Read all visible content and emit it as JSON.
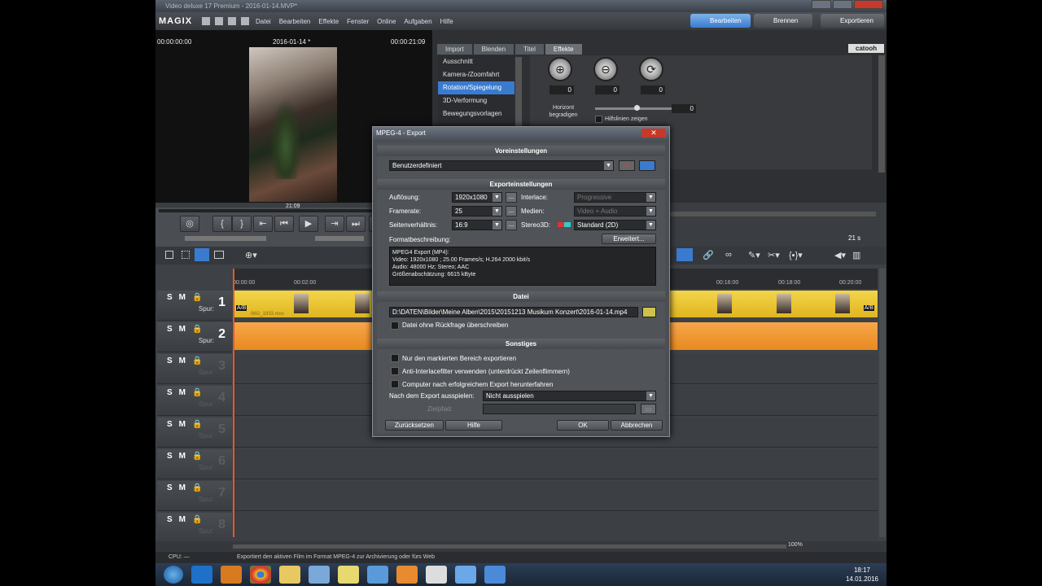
{
  "window": {
    "title": "Video deluxe 17 Premium - 2016-01-14.MVP*"
  },
  "menubar": {
    "logo": "MAGIX",
    "items": [
      "Datei",
      "Bearbeiten",
      "Effekte",
      "Fenster",
      "Online",
      "Aufgaben",
      "Hilfe"
    ],
    "modes": [
      "Bearbeiten",
      "Brennen",
      "Exportieren"
    ]
  },
  "preview": {
    "time_start": "00:00:00:00",
    "title": "2016-01-14 *",
    "time_end": "00:00:21:09",
    "marker": "21:09"
  },
  "right_panel": {
    "tabs": [
      "Import",
      "Blenden",
      "Titel",
      "Effekte"
    ],
    "active_tab": "Effekte",
    "brand": "catooh",
    "fx_items": [
      "Ausschnitt",
      "Kamera-/Zoomfahrt",
      "Rotation/Spiegelung",
      "3D-Verformung",
      "Bewegungsvorlagen"
    ],
    "selected_fx": "Rotation/Spiegelung",
    "values": [
      "0",
      "0",
      "0"
    ],
    "horizon_label": "Horizont begradigen",
    "horizon_value": "0",
    "hilfslinien": "Hilfslinien zeigen"
  },
  "timeline": {
    "duration": "21 s",
    "ruler_ticks": [
      "00:00:00",
      "00:02:00",
      "00:16:00",
      "00:18:00",
      "00:20:00"
    ],
    "track_label": "Spur:",
    "tracks": [
      "1",
      "2",
      "3",
      "4",
      "5",
      "6",
      "7",
      "8"
    ],
    "clip1_name": "IMG_1833.mov",
    "zoom": "100%",
    "cpu": "CPU: —"
  },
  "status": {
    "text": "Exportiert den aktiven Film im Format MPEG-4 zur Archivierung oder fürs Web"
  },
  "dialog": {
    "title": "MPEG-4 - Export",
    "close": "✕",
    "sec_presets": "Voreinstellungen",
    "preset_value": "Benutzerdefiniert",
    "sec_export": "Exporteinstellungen",
    "lbl_resolution": "Auflösung:",
    "val_resolution": "1920x1080",
    "lbl_interlace": "Interlace:",
    "val_interlace": "Progressive",
    "lbl_framerate": "Framerate:",
    "val_framerate": "25",
    "lbl_media": "Medien:",
    "val_media": "Video + Audio",
    "lbl_aspect": "Seitenverhältnis:",
    "val_aspect": "16:9",
    "lbl_stereo": "Stereo3D:",
    "val_stereo": "Standard (2D)",
    "lbl_fmtdesc": "Formatbeschreibung:",
    "btn_advanced": "Erweitert...",
    "fmtdesc": "MPEG4 Export (MP4):\nVideo: 1920x1080 ; 25.00 Frames/s; H.264 2000 kbit/s\nAudio: 48000 Hz; Stereo; AAC\nGrößenabschätzung: 6615 kByte",
    "sec_file": "Datei",
    "file_path": "D:\\DATEN\\Bilder\\Meine Alben\\2015\\20151213 Musikum Konzert\\2016-01-14.mp4",
    "chk_overwrite": "Datei ohne Rückfrage überschreiben",
    "sec_misc": "Sonstiges",
    "chk_marked": "Nur den markierten Bereich exportieren",
    "chk_antiinterlace": "Anti-Interlacefilter verwenden (unterdrückt Zeilenflimmern)",
    "chk_shutdown": "Computer nach erfolgreichem Export herunterfahren",
    "lbl_after": "Nach dem Export ausspielen:",
    "val_after": "Nicht ausspielen",
    "lbl_target": "Zielpfad:",
    "btn_reset": "Zurücksetzen",
    "btn_help": "Hilfe",
    "btn_ok": "OK",
    "btn_cancel": "Abbrechen"
  },
  "taskbar": {
    "time": "18:17",
    "date": "14.01.2016"
  },
  "colors": {
    "accent": "#3a7bd0",
    "clip_yellow": "#f3d54a",
    "clip_orange": "#f7a64a",
    "close_red": "#c8382a"
  }
}
